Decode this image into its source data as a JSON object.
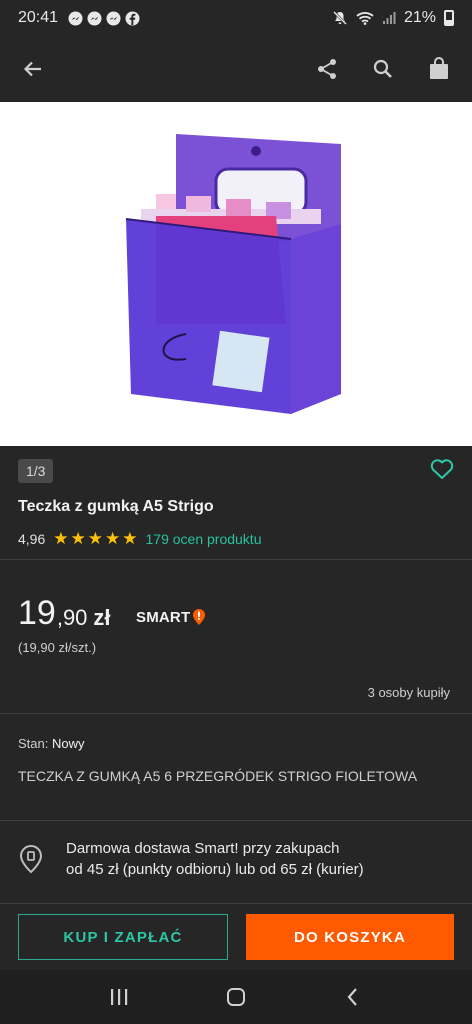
{
  "status_bar": {
    "time": "20:41",
    "notifications": [
      "messenger-icon",
      "messenger-icon",
      "messenger-icon",
      "facebook-icon"
    ],
    "battery": "21%"
  },
  "app_bar": {
    "icons": [
      "back-arrow-icon",
      "share-icon",
      "search-icon",
      "shopping-bag-icon"
    ]
  },
  "gallery": {
    "counter": "1/3"
  },
  "product": {
    "title": "Teczka z gumką A5 Strigo",
    "rating_score": "4,96",
    "stars": 5,
    "reviews_link": "179 ocen produktu",
    "price_integer": "19",
    "price_decimal": ",90",
    "currency": "zł",
    "smart_badge": "SMART",
    "unit_price": "(19,90 zł/szt.)",
    "bought_count": "3 osoby kupiły",
    "condition_label": "Stan:",
    "condition_value": "Nowy",
    "description": "TECZKA Z GUMKĄ A5 6 PRZEGRÓDEK STRIGO FIOLETOWA"
  },
  "delivery": {
    "line1": "Darmowa dostawa Smart! przy zakupach",
    "line2": "od 45 zł (punkty odbioru) lub od 65 zł (kurier)"
  },
  "actions": {
    "buy_now": "KUP I ZAPŁAĆ",
    "add_to_cart": "DO KOSZYKA"
  },
  "colors": {
    "accent_teal": "#2ec7a6",
    "cta_orange": "#ff5a00",
    "star_yellow": "#ffc107",
    "background": "#262626"
  }
}
